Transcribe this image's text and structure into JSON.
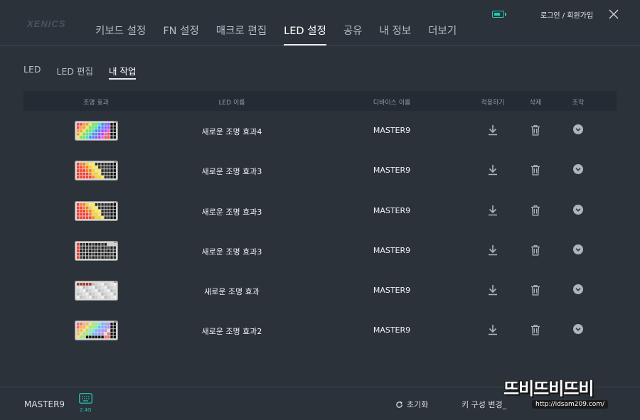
{
  "brand": {
    "logo": "XENICS"
  },
  "main_nav": [
    {
      "label": "키보드 설정",
      "active": false
    },
    {
      "label": "FN 설정",
      "active": false
    },
    {
      "label": "매크로 편집",
      "active": false
    },
    {
      "label": "LED 설정",
      "active": true
    },
    {
      "label": "공유",
      "active": false
    },
    {
      "label": "내 정보",
      "active": false
    },
    {
      "label": "더보기",
      "active": false
    }
  ],
  "header": {
    "login_label": "로그인 / 회원가입",
    "battery_color": "#24c7b3"
  },
  "sub_tabs": [
    {
      "label": "LED",
      "active": false
    },
    {
      "label": "LED 편집",
      "active": false
    },
    {
      "label": "내 작업",
      "active": true
    }
  ],
  "table": {
    "headers": {
      "effect": "조명 효과",
      "led_name": "LED 이름",
      "device_name": "디바이스 이름",
      "apply": "적용하기",
      "delete": "삭제",
      "action": "조작"
    },
    "rows": [
      {
        "led_name": "새로운 조명 효과4",
        "device_name": "MASTER9",
        "preview": "rainbow"
      },
      {
        "led_name": "새로운 조명 효과3",
        "device_name": "MASTER9",
        "preview": "warm"
      },
      {
        "led_name": "새로운 조명 효과3",
        "device_name": "MASTER9",
        "preview": "warm"
      },
      {
        "led_name": "새로운 조명 효과3",
        "device_name": "MASTER9",
        "preview": "dark"
      },
      {
        "led_name": "새로운 조명 효과",
        "device_name": "MASTER9",
        "preview": "white"
      },
      {
        "led_name": "새로운 조명 효과2",
        "device_name": "MASTER9",
        "preview": "pastel"
      }
    ]
  },
  "footer": {
    "device_name": "MASTER9",
    "connection": "2.4G",
    "reset_label": "초기화",
    "key_config_label": "키 구성 변경_",
    "accent_color": "#24c7b3"
  },
  "watermark": {
    "title": "뜨비뜨비뜨비",
    "url": "http://idsam209.com/"
  }
}
